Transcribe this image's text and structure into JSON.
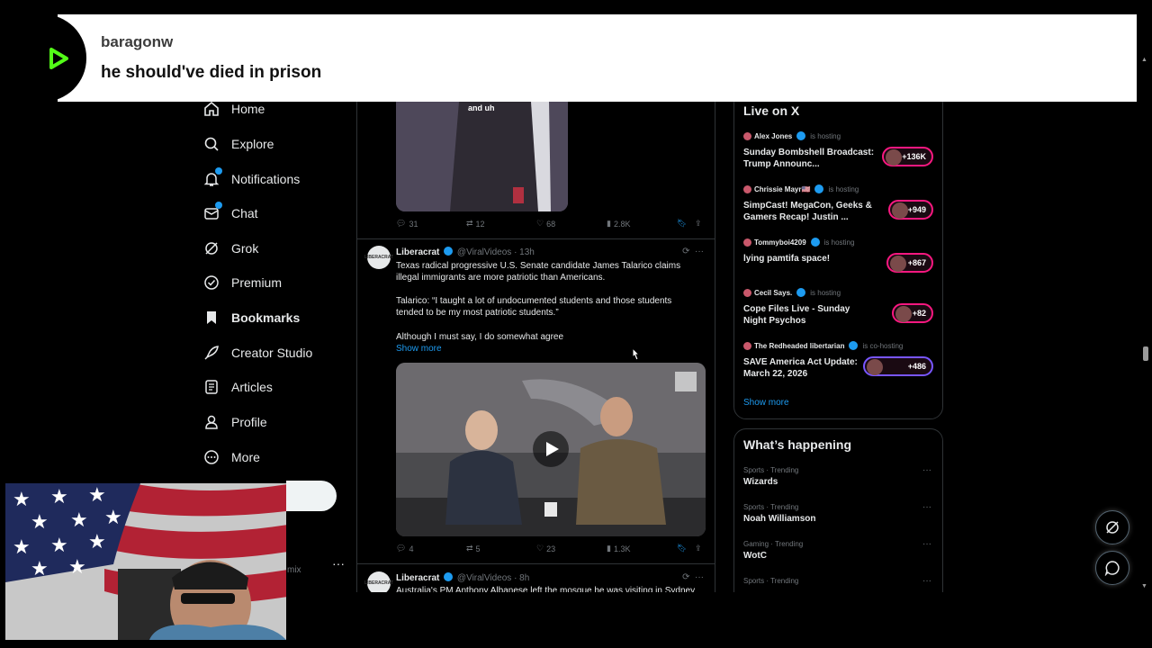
{
  "chat": {
    "username": "baragonw",
    "message": "he should've died in prison"
  },
  "sidebar": {
    "items": [
      {
        "label": "Home",
        "icon": "home-icon"
      },
      {
        "label": "Explore",
        "icon": "search-icon"
      },
      {
        "label": "Notifications",
        "icon": "bell-icon"
      },
      {
        "label": "Chat",
        "icon": "mail-icon"
      },
      {
        "label": "Grok",
        "icon": "grok-icon"
      },
      {
        "label": "Premium",
        "icon": "premium-icon"
      },
      {
        "label": "Bookmarks",
        "icon": "bookmark-icon"
      },
      {
        "label": "Creator Studio",
        "icon": "rocket-icon"
      },
      {
        "label": "Articles",
        "icon": "article-icon"
      },
      {
        "label": "Profile",
        "icon": "person-icon"
      },
      {
        "label": "More",
        "icon": "more-circle-icon"
      }
    ],
    "account_handle_fragment": "mix",
    "account_more": "···"
  },
  "feed": {
    "video1_caption": "and uh",
    "post1_actions": {
      "replies": "31",
      "reposts": "12",
      "likes": "68",
      "views": "2.8K"
    },
    "post2": {
      "avatar_text": "LIBERACRAT",
      "name": "Liberacrat",
      "handle_meta": "@ViralVideos · 13h",
      "text_lines": [
        "Texas radical progressive U.S. Senate candidate James Talarico claims illegal immigrants are more patriotic than Americans.",
        "Talarico: “I taught a lot of undocumented students and those students tended to be my most patriotic students.”",
        "Although I must say, I do somewhat agree"
      ],
      "show_more": "Show more",
      "actions": {
        "replies": "4",
        "reposts": "5",
        "likes": "23",
        "views": "1.3K"
      }
    },
    "post3": {
      "avatar_text": "LIBERACRAT",
      "name": "Liberacrat",
      "handle_meta": "@ViralVideos · 8h",
      "text": "Australia's PM Anthony Albanese left the mosque he was visiting in Sydney"
    }
  },
  "live": {
    "title": "Live on X",
    "spaces": [
      {
        "host": "Alex Jones",
        "role": "is hosting",
        "title": "Sunday Bombshell Broadcast: Trump Announc...",
        "listeners": "+136K"
      },
      {
        "host": "Chrissie Mayr🇺🇸",
        "role": "is hosting",
        "title": "SimpCast! MegaCon, Geeks & Gamers Recap! Justin ...",
        "listeners": "+949"
      },
      {
        "host": "Tommyboi4209",
        "role": "is hosting",
        "title": "lying pamtifa space!",
        "listeners": "+867"
      },
      {
        "host": "Cecil Says.",
        "role": "is hosting",
        "title": "Cope Files Live - Sunday Night Psychos",
        "listeners": "+82"
      },
      {
        "host": "The Redheaded libertarian",
        "role": "is co-hosting",
        "title": "SAVE America Act Update: March 22, 2026",
        "listeners": "+486"
      }
    ],
    "show_more": "Show more"
  },
  "trends": {
    "title": "What’s happening",
    "items": [
      {
        "meta": "Sports · Trending",
        "name": "Wizards"
      },
      {
        "meta": "Sports · Trending",
        "name": "Noah Williamson"
      },
      {
        "meta": "Gaming · Trending",
        "name": "WotC"
      },
      {
        "meta": "Sports · Trending",
        "name": ""
      }
    ]
  },
  "colors": {
    "accent": "#1d9bf0",
    "live_ring": "#f91880",
    "live_ring_alt": "#7856ff",
    "background": "#000000"
  }
}
